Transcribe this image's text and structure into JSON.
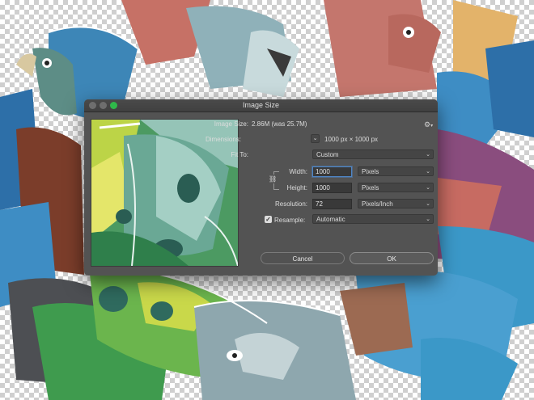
{
  "dialog": {
    "title": "Image Size",
    "image_size_label": "Image Size:",
    "image_size_value": "2.86M (was 25.7M)",
    "dimensions_label": "Dimensions:",
    "dimensions_toggle_glyph": "⌄",
    "dimensions_value": "1000 px  ×  1000 px",
    "fit_to_label": "Fit To:",
    "fit_to_value": "Custom",
    "width_label": "Width:",
    "width_value": "1000",
    "width_unit": "Pixels",
    "height_label": "Height:",
    "height_value": "1000",
    "height_unit": "Pixels",
    "resolution_label": "Resolution:",
    "resolution_value": "72",
    "resolution_unit": "Pixels/Inch",
    "resample_label": "Resample:",
    "resample_checked": true,
    "resample_value": "Automatic",
    "cancel_label": "Cancel",
    "ok_label": "OK",
    "gear_icon": "gear-icon",
    "link_icon": "chain-link-icon",
    "zoom_button_color": "#2fb84a",
    "focus_color": "#4f86c6"
  }
}
